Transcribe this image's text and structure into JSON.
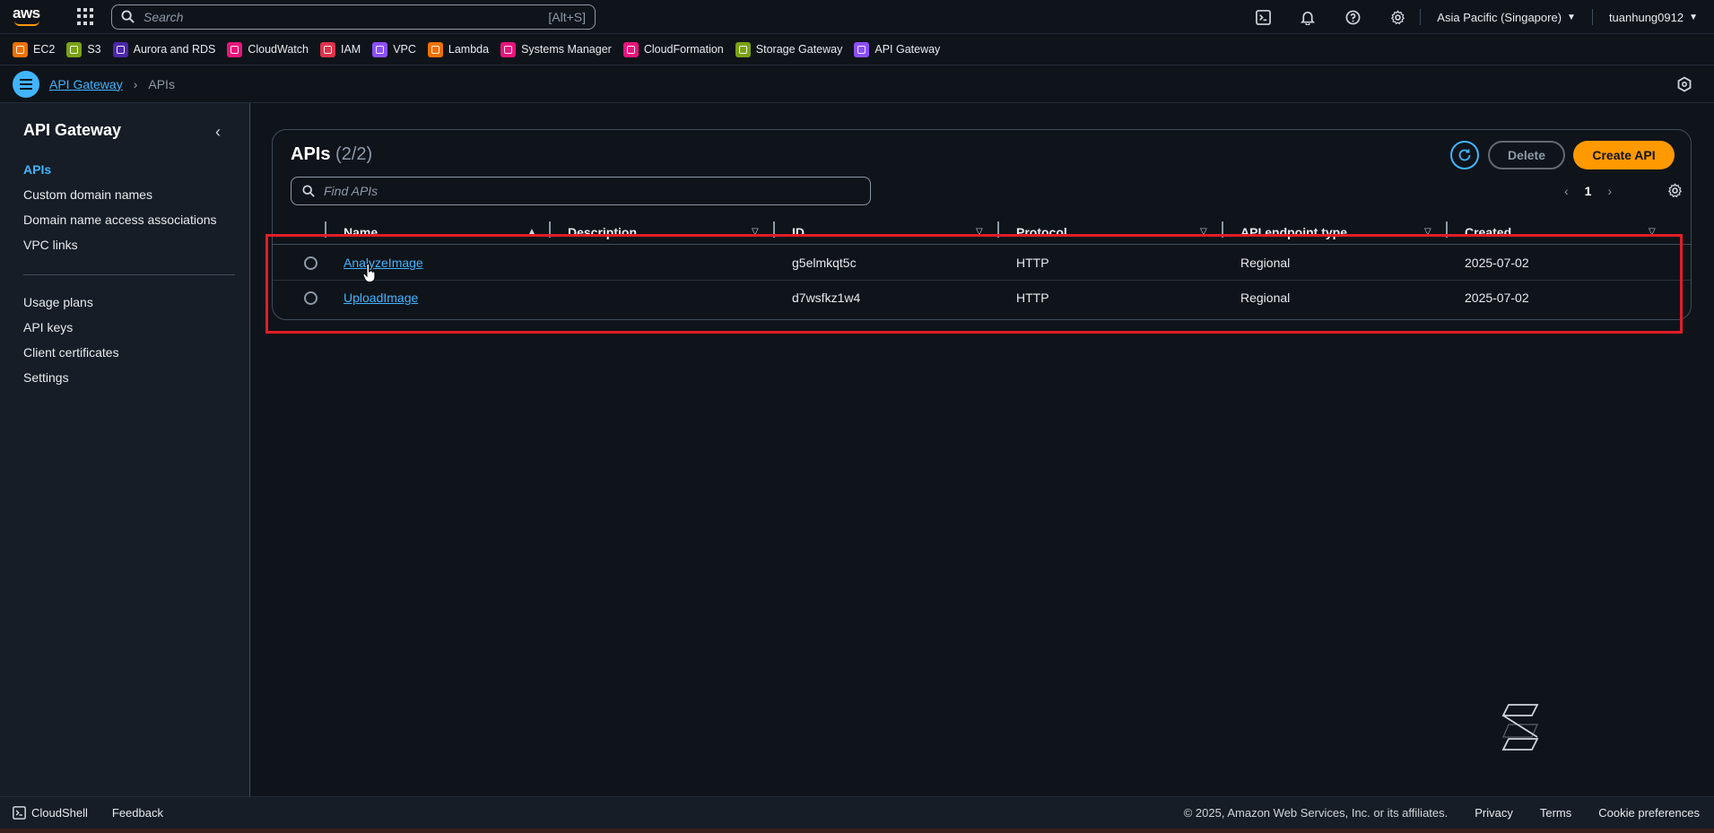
{
  "topnav": {
    "search_placeholder": "Search",
    "search_shortcut": "[Alt+S]",
    "region": "Asia Pacific (Singapore)",
    "user": "tuanhung0912"
  },
  "favorites": [
    {
      "label": "EC2",
      "color": "#ed7100"
    },
    {
      "label": "S3",
      "color": "#7aa116"
    },
    {
      "label": "Aurora and RDS",
      "color": "#4d27aa"
    },
    {
      "label": "CloudWatch",
      "color": "#e7157b"
    },
    {
      "label": "IAM",
      "color": "#dd344c"
    },
    {
      "label": "VPC",
      "color": "#8c4fff"
    },
    {
      "label": "Lambda",
      "color": "#ed7100"
    },
    {
      "label": "Systems Manager",
      "color": "#e7157b"
    },
    {
      "label": "CloudFormation",
      "color": "#e7157b"
    },
    {
      "label": "Storage Gateway",
      "color": "#7aa116"
    },
    {
      "label": "API Gateway",
      "color": "#8c4fff"
    }
  ],
  "breadcrumb": {
    "parent": "API Gateway",
    "current": "APIs"
  },
  "sidebar": {
    "title": "API Gateway",
    "items": [
      {
        "label": "APIs"
      },
      {
        "label": "Custom domain names"
      },
      {
        "label": "Domain name access associations"
      },
      {
        "label": "VPC links"
      }
    ],
    "items2": [
      {
        "label": "Usage plans"
      },
      {
        "label": "API keys"
      },
      {
        "label": "Client certificates"
      },
      {
        "label": "Settings"
      }
    ]
  },
  "panel": {
    "title": "APIs",
    "count": "(2/2)",
    "delete_label": "Delete",
    "create_label": "Create API",
    "find_placeholder": "Find APIs",
    "page_number": "1"
  },
  "table": {
    "columns": [
      "Name",
      "Description",
      "ID",
      "Protocol",
      "API endpoint type",
      "Created"
    ],
    "rows": [
      {
        "name": "AnalyzeImage",
        "description": "",
        "id": "g5elmkqt5c",
        "protocol": "HTTP",
        "endpoint": "Regional",
        "created": "2025-07-02"
      },
      {
        "name": "UploadImage",
        "description": "",
        "id": "d7wsfkz1w4",
        "protocol": "HTTP",
        "endpoint": "Regional",
        "created": "2025-07-02"
      }
    ]
  },
  "footer": {
    "cloudshell": "CloudShell",
    "feedback": "Feedback",
    "copyright": "© 2025, Amazon Web Services, Inc. or its affiliates.",
    "privacy": "Privacy",
    "terms": "Terms",
    "cookies": "Cookie preferences"
  }
}
